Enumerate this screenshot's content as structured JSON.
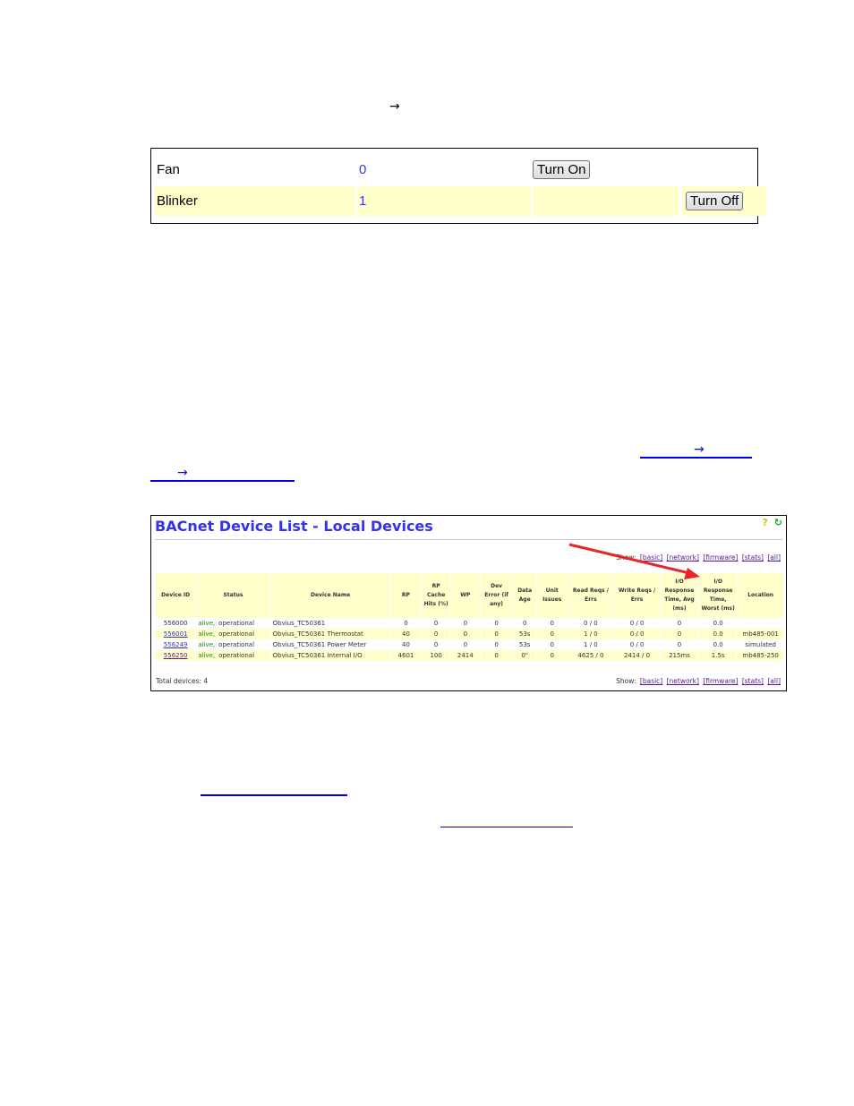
{
  "top_arrow": "→",
  "controls": {
    "rows": [
      {
        "name": "Fan",
        "value": "0",
        "button": "Turn On",
        "button_column": 1
      },
      {
        "name": "Blinker",
        "value": "1",
        "button": "Turn Off",
        "button_column": 2
      }
    ]
  },
  "links": {
    "arrow_1": "→",
    "arrow_2": "→"
  },
  "bacnet": {
    "title": "BACnet Device List - Local Devices",
    "help_icon": "?",
    "refresh_icon": "↻",
    "show_label": "Show:",
    "show_links": [
      "[basic]",
      "[network]",
      "[firmware]",
      "[stats]",
      "[all]"
    ],
    "columns": [
      "Device ID",
      "Status",
      "Device Name",
      "RP",
      "RP Cache Hits (%)",
      "WP",
      "Dev Error (if any)",
      "Data Age",
      "Unit Issues",
      "Read Reqs / Errs",
      "Write Reqs / Errs",
      "I/O Response Time, Avg (ms)",
      "I/O Response Time, Worst (ms)",
      "Location"
    ],
    "rows": [
      {
        "id": "556000",
        "id_link": false,
        "status": "alive,",
        "status2": "operational",
        "name": "Obvius_TC50361",
        "rp": "0",
        "cache": "0",
        "wp": "0",
        "err": "0",
        "age": "0",
        "unit": "0",
        "read": "0 / 0",
        "write": "0 / 0",
        "avg": "0",
        "worst": "0.0",
        "loc": ""
      },
      {
        "id": "556001",
        "id_link": true,
        "status": "alive,",
        "status2": "operational",
        "name": "Obvius_TC50361 Thermostat",
        "rp": "40",
        "cache": "0",
        "wp": "0",
        "err": "0",
        "age": "53s",
        "unit": "0",
        "read": "1 / 0",
        "write": "0 / 0",
        "avg": "0",
        "worst": "0.0",
        "loc": "mb485-001"
      },
      {
        "id": "556249",
        "id_link": true,
        "status": "alive,",
        "status2": "operational",
        "name": "Obvius_TC50361 Power Meter",
        "rp": "40",
        "cache": "0",
        "wp": "0",
        "err": "0",
        "age": "53s",
        "unit": "0",
        "read": "1 / 0",
        "write": "0 / 0",
        "avg": "0",
        "worst": "0.0",
        "loc": "simulated"
      },
      {
        "id": "556250",
        "id_link": true,
        "status": "alive,",
        "status2": "operational",
        "name": "Obvius_TC50361 Internal I/O",
        "rp": "4601",
        "cache": "100",
        "wp": "2414",
        "err": "0",
        "age": "0\"",
        "unit": "0",
        "read": "4625 / 0",
        "write": "2414 / 0",
        "avg": "215ms",
        "worst": "1.5s",
        "loc": "mb485-250"
      }
    ],
    "total": "Total devices: 4",
    "annotation_color": "#e8262a"
  }
}
